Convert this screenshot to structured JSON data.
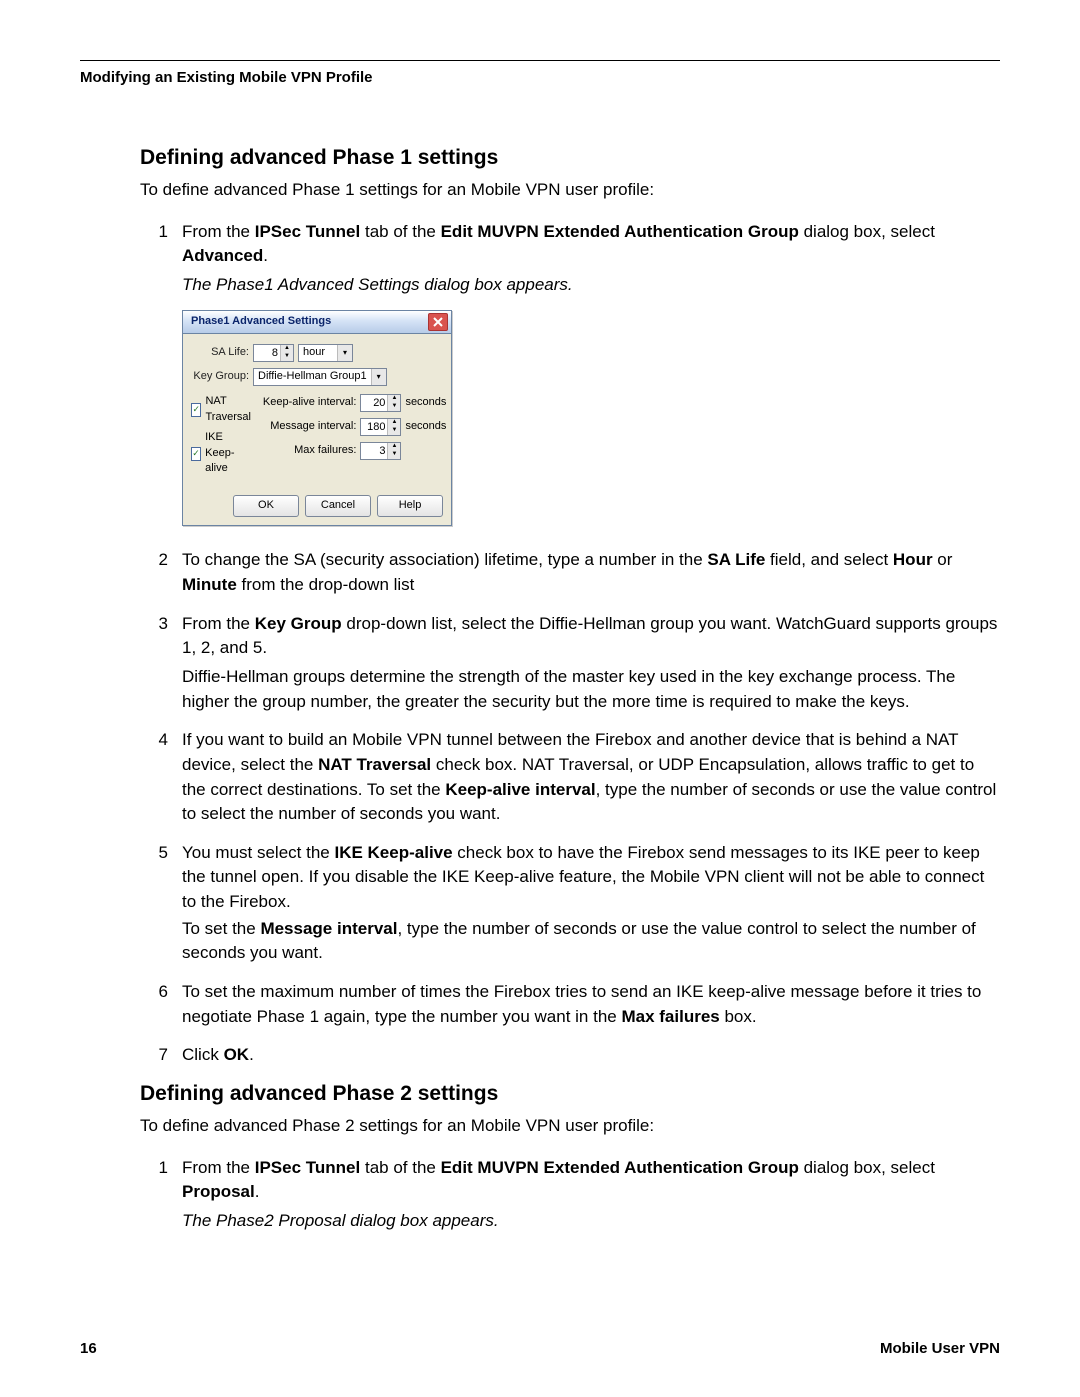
{
  "header": "Modifying an Existing Mobile VPN Profile",
  "phase1": {
    "heading": "Defining advanced Phase 1 settings",
    "intro": "To define advanced Phase 1 settings for an Mobile VPN user profile:",
    "steps": {
      "s1a": "From the ",
      "s1b": "IPSec Tunnel",
      "s1c": " tab of the ",
      "s1d": "Edit MUVPN Extended Authentication Group",
      "s1e": " dialog box, select ",
      "s1f": "Advanced",
      "s1g": ".",
      "s1note": "The Phase1 Advanced Settings dialog box appears.",
      "s2a": "To change the SA (security association) lifetime, type a number in the ",
      "s2b": "SA Life",
      "s2c": " field, and select ",
      "s2d": "Hour",
      "s2e": " or ",
      "s2f": "Minute",
      "s2g": " from the drop-down list",
      "s3a": "From the ",
      "s3b": "Key Group",
      "s3c": " drop-down list, select the Diffie-Hellman group you want. WatchGuard supports groups 1, 2, and 5.",
      "s3p2": "Diffie-Hellman groups determine the strength of the master key used in the key exchange process. The higher the group number, the greater the security but the more time is required to make the keys.",
      "s4a": "If you want to build an Mobile VPN tunnel between the Firebox and another device that is behind a NAT device, select the ",
      "s4b": "NAT Traversal",
      "s4c": " check box. NAT Traversal, or UDP Encapsulation, allows traffic to get to the correct destinations. To set the ",
      "s4d": "Keep-alive interval",
      "s4e": ", type the number of seconds or use the value control to select the number of seconds you want.",
      "s5a": "You must select the ",
      "s5b": "IKE Keep-alive",
      "s5c": " check box to have the Firebox send messages to its IKE peer to keep the tunnel open. If you disable the IKE Keep-alive feature, the Mobile VPN client will not be able to connect to the Firebox.",
      "s5p2a": "To set the ",
      "s5p2b": "Message interval",
      "s5p2c": ", type the number of seconds or use the value control to select the number of seconds you want.",
      "s6a": "To set the maximum number of times the Firebox tries to send an IKE keep-alive message before it tries to negotiate Phase 1 again, type the number you want in the ",
      "s6b": "Max failures",
      "s6c": " box.",
      "s7a": "Click ",
      "s7b": "OK",
      "s7c": "."
    }
  },
  "dialog": {
    "title": "Phase1 Advanced Settings",
    "sa_life_label": "SA Life:",
    "sa_life_value": "8",
    "sa_life_unit": "hour",
    "key_group_label": "Key Group:",
    "key_group_value": "Diffie-Hellman Group1",
    "nat_label": "NAT Traversal",
    "ike_label": "IKE Keep-alive",
    "keep_alive_label": "Keep-alive interval:",
    "keep_alive_value": "20",
    "msg_interval_label": "Message interval:",
    "msg_interval_value": "180",
    "max_fail_label": "Max failures:",
    "max_fail_value": "3",
    "seconds": "seconds",
    "ok": "OK",
    "cancel": "Cancel",
    "help": "Help"
  },
  "phase2": {
    "heading": "Defining advanced Phase 2 settings",
    "intro": "To define advanced Phase 2 settings for an Mobile VPN user profile:",
    "s1a": "From the ",
    "s1b": "IPSec Tunnel",
    "s1c": " tab of the ",
    "s1d": "Edit MUVPN Extended Authentication Group",
    "s1e": " dialog box, select ",
    "s1f": "Proposal",
    "s1g": ".",
    "s1note": "The Phase2 Proposal dialog box appears."
  },
  "footer": {
    "page": "16",
    "doc": "Mobile User VPN"
  }
}
